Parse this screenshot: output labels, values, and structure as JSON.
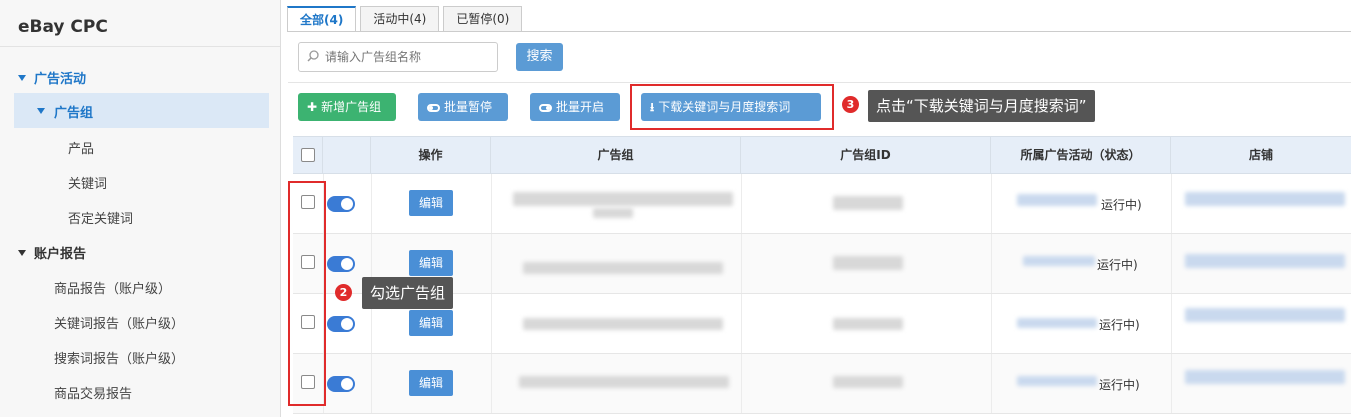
{
  "sidebar": {
    "brand": "eBay CPC",
    "groups": [
      {
        "label": "广告活动"
      },
      {
        "label": "账户报告"
      }
    ],
    "active_item": "广告组",
    "sub_items": [
      "产品",
      "关键词",
      "否定关键词"
    ],
    "report_items": [
      "商品报告（账户级）",
      "关键词报告（账户级）",
      "搜索词报告（账户级）",
      "商品交易报告"
    ]
  },
  "tabs": [
    {
      "label": "全部(4)",
      "active": true
    },
    {
      "label": "活动中(4)",
      "active": false
    },
    {
      "label": "已暂停(0)",
      "active": false
    }
  ],
  "search": {
    "placeholder": "请输入广告组名称",
    "button_label": "搜索"
  },
  "toolbar": {
    "add_label": "新增广告组",
    "pause_label": "批量暂停",
    "enable_label": "批量开启",
    "download_label": "下载关键词与月度搜索词"
  },
  "annotations": {
    "step2_num": "2",
    "step2_text": "勾选广告组",
    "step3_num": "3",
    "step3_text": "点击“下载关键词与月度搜索词”",
    "highlight_color": "#e02b2b"
  },
  "table": {
    "headers": [
      "操作",
      "广告组",
      "广告组ID",
      "所属广告活动（状态）",
      "店铺"
    ],
    "rows": [
      {
        "edit_label": "编辑",
        "status": "运行中)"
      },
      {
        "edit_label": "编辑",
        "status": "运行中)"
      },
      {
        "edit_label": "编辑",
        "status": "运行中)"
      },
      {
        "edit_label": "编辑",
        "status": "运行中)"
      }
    ]
  },
  "colors": {
    "accent": "#1f77c8",
    "primary_button": "#5b9bd5",
    "add_button": "#3cb371",
    "switch_on": "#3a7bd5"
  }
}
